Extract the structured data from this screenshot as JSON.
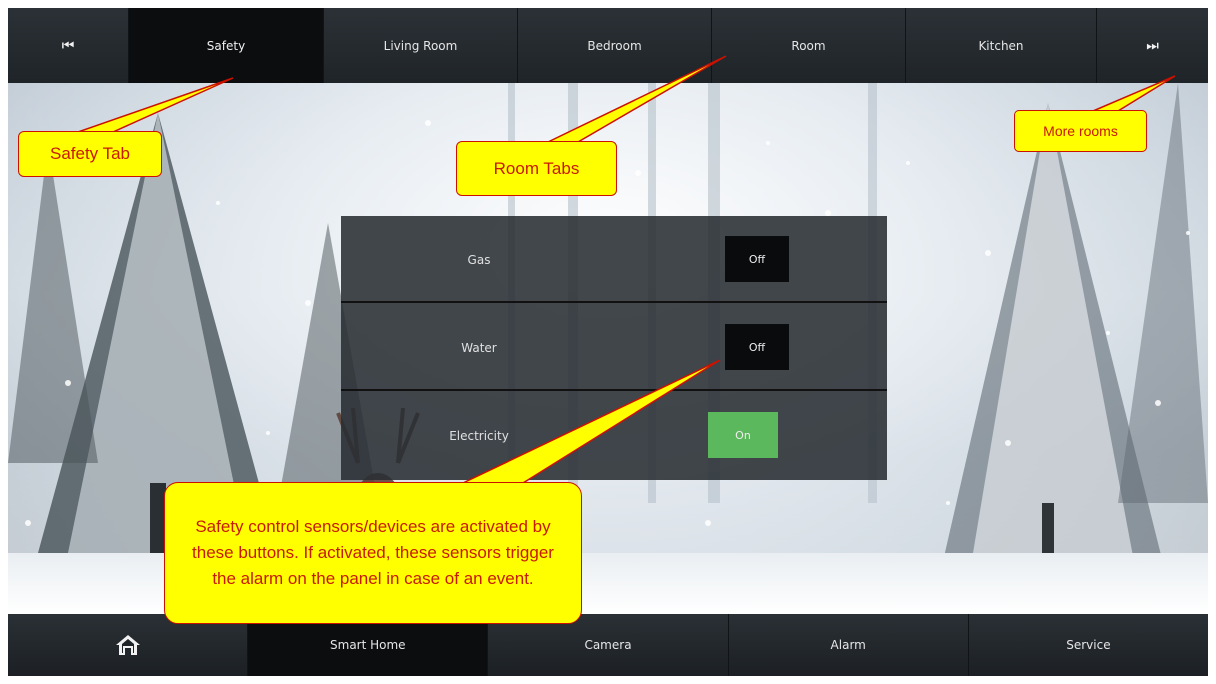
{
  "top_tabs": [
    {
      "label": "Safety",
      "active": true
    },
    {
      "label": "Living Room",
      "active": false
    },
    {
      "label": "Bedroom",
      "active": false
    },
    {
      "label": "Room",
      "active": false
    },
    {
      "label": "Kitchen",
      "active": false
    }
  ],
  "icons": {
    "prev": "skip-previous-icon",
    "next": "skip-next-icon",
    "home": "home-icon"
  },
  "controls": [
    {
      "label": "Gas",
      "state": "Off"
    },
    {
      "label": "Water",
      "state": "Off"
    },
    {
      "label": "Electricity",
      "state": "On"
    }
  ],
  "bottom_tabs": [
    {
      "label": "Smart Home",
      "active": true
    },
    {
      "label": "Camera",
      "active": false
    },
    {
      "label": "Alarm",
      "active": false
    },
    {
      "label": "Service",
      "active": false
    }
  ],
  "annotations": {
    "safety_tab": "Safety Tab",
    "room_tabs": "Room Tabs",
    "more_rooms": "More rooms",
    "sensors": "Safety control sensors/devices are activated by these buttons. If activated, these sensors trigger the alarm on the panel in case of an event."
  },
  "colors": {
    "on": "#5cb85c",
    "off": "#0a0b0c",
    "callout_fill": "#ffff00",
    "callout_border": "#cc1100"
  }
}
